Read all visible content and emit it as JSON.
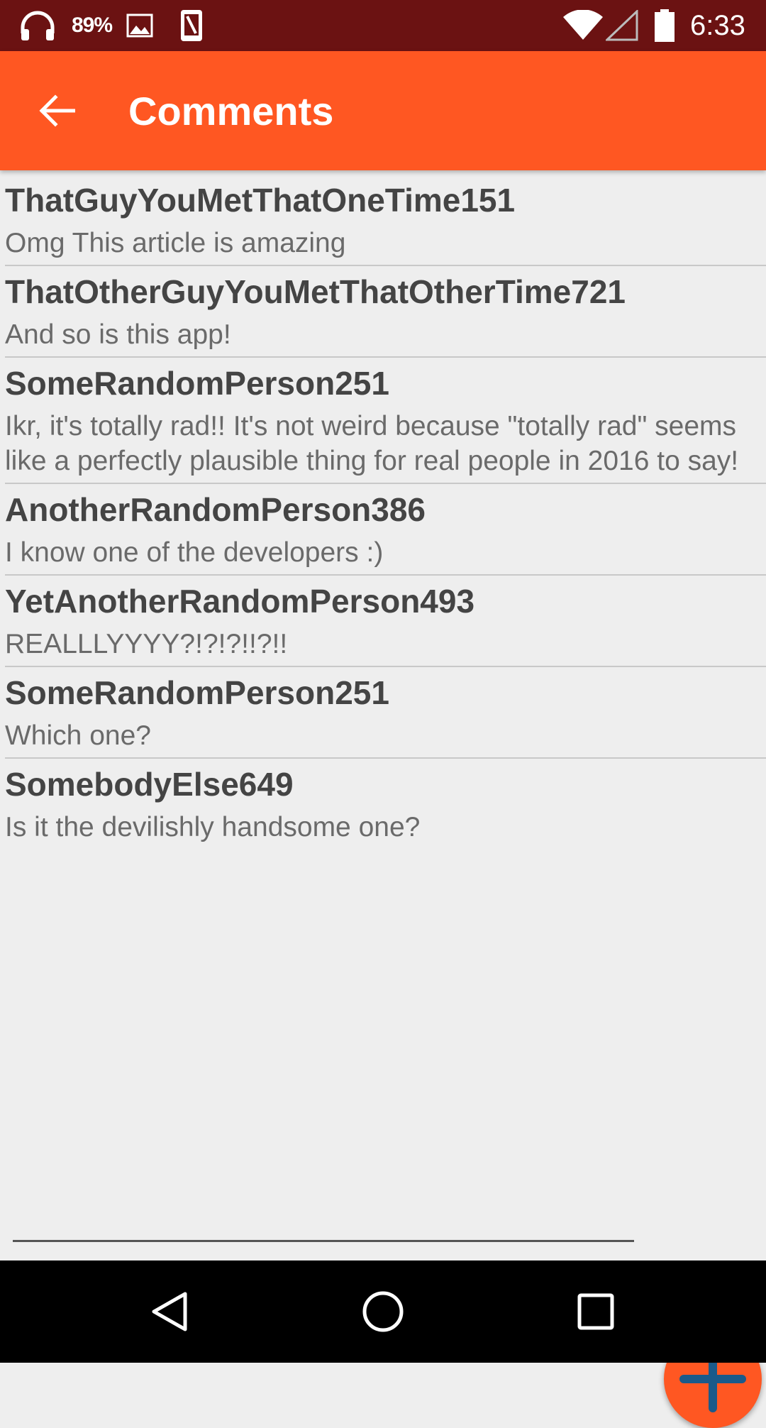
{
  "status_bar": {
    "battery_percent_text": "89%",
    "time": "6:33",
    "icons": [
      "headphones-icon",
      "image-icon",
      "phone-icon",
      "wifi-icon",
      "signal-icon",
      "battery-icon"
    ]
  },
  "app_bar": {
    "title": "Comments",
    "back_icon": "arrow-back-icon",
    "color": "#ff5722"
  },
  "comments": [
    {
      "author": "ThatGuyYouMetThatOneTime151",
      "text": "Omg This article is amazing"
    },
    {
      "author": "ThatOtherGuyYouMetThatOtherTime721",
      "text": "And so is this app!"
    },
    {
      "author": "SomeRandomPerson251",
      "text": "Ikr, it's totally rad!! It's not weird because \"totally rad\" seems like a perfectly plausible thing for real people in 2016 to say!"
    },
    {
      "author": "AnotherRandomPerson386",
      "text": "I know one of the developers :)"
    },
    {
      "author": "YetAnotherRandomPerson493",
      "text": "REALLLYYYY?!?!?!!?!!"
    },
    {
      "author": "SomeRandomPerson251",
      "text": "Which one?"
    },
    {
      "author": "SomebodyElse649",
      "text": "Is it the devilishly handsome one?"
    }
  ],
  "comment_input": {
    "value": "",
    "placeholder": ""
  },
  "fab": {
    "icon": "plus-icon",
    "background": "#ff5722",
    "icon_color": "#1a5a8a"
  },
  "nav_bar": {
    "icons": [
      "back-triangle-icon",
      "home-circle-icon",
      "recents-square-icon"
    ]
  }
}
